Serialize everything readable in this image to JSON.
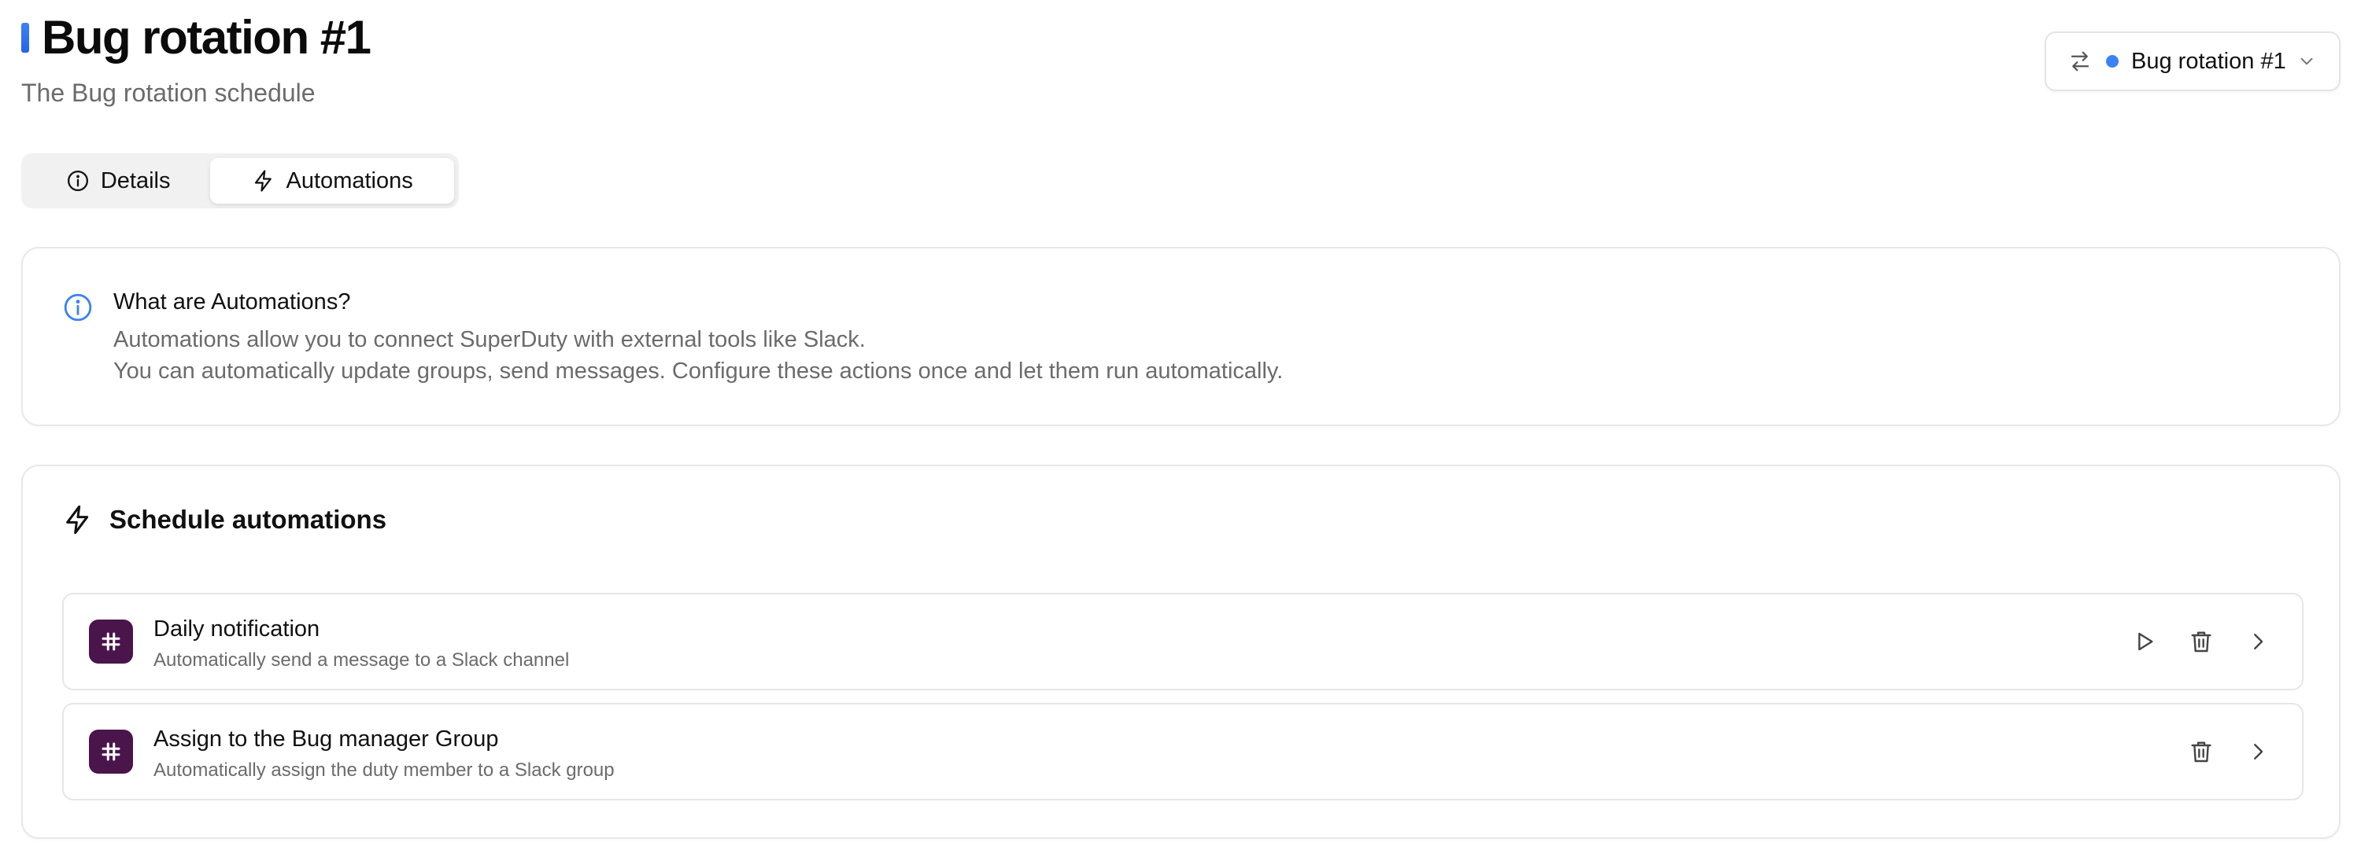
{
  "page": {
    "title": "Bug rotation #1",
    "subtitle": "The Bug rotation schedule"
  },
  "switcher": {
    "label": "Bug rotation #1",
    "dot_color": "#3b82f6"
  },
  "tabs": [
    {
      "label": "Details",
      "icon": "info-icon",
      "active": false
    },
    {
      "label": "Automations",
      "icon": "lightning-icon",
      "active": true
    }
  ],
  "info": {
    "title": "What are Automations?",
    "line1": "Automations allow you to connect SuperDuty with external tools like Slack.",
    "line2": "You can automatically update groups, send messages. Configure these actions once and let them run automatically."
  },
  "schedule": {
    "title": "Schedule automations",
    "items": [
      {
        "title": "Daily notification",
        "description": "Automatically send a message to a Slack channel",
        "icon": "slack-icon",
        "actions": [
          "play-icon",
          "trash-icon",
          "chevron-right-icon"
        ]
      },
      {
        "title": "Assign to the Bug manager Group",
        "description": "Automatically assign the duty member to a Slack group",
        "icon": "slack-icon",
        "actions": [
          "trash-icon",
          "chevron-right-icon"
        ]
      }
    ]
  },
  "colors": {
    "accent": "#3b82f6",
    "slack_purple": "#4a154b"
  }
}
